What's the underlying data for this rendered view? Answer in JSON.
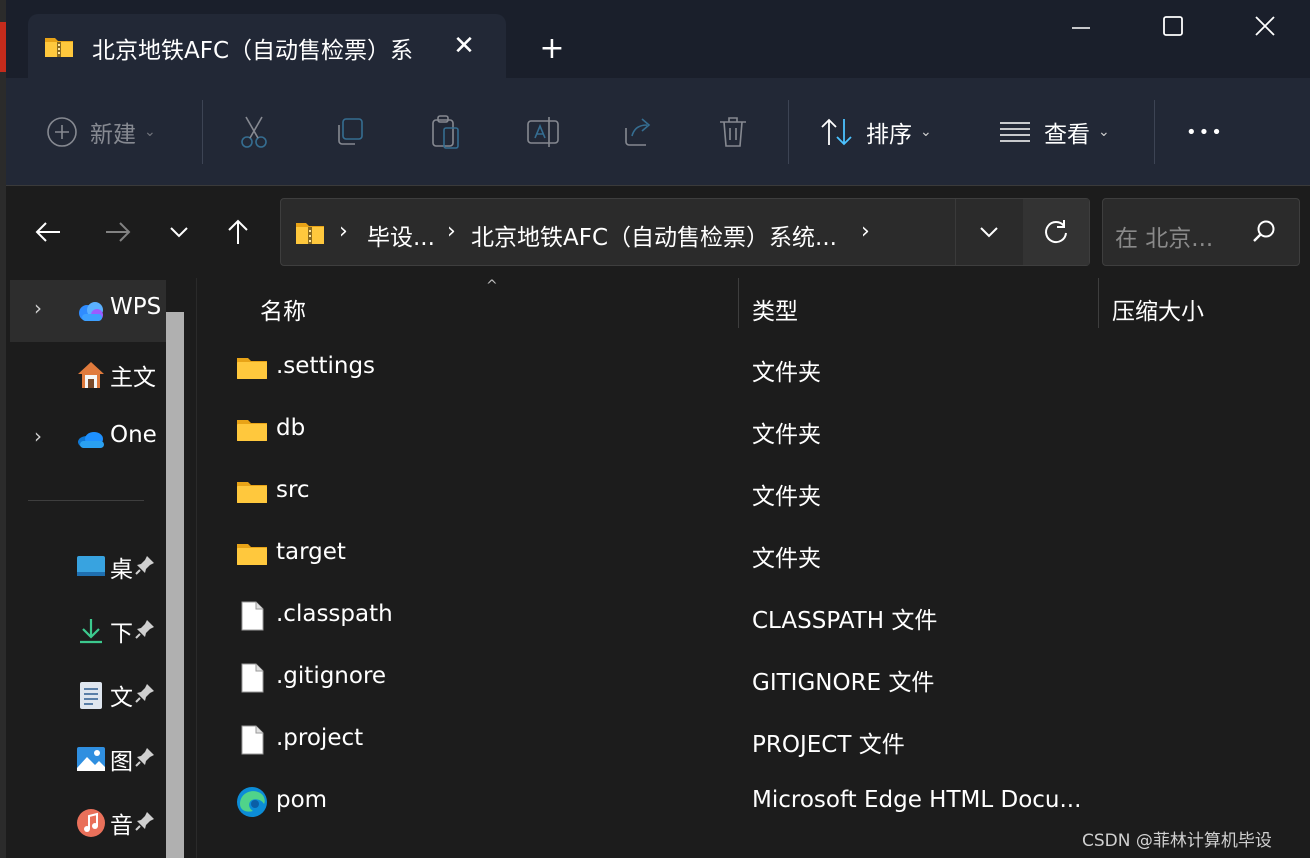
{
  "window": {
    "tab_title": "北京地铁AFC（自动售检票）系",
    "new_tab_symbol": "+",
    "close_tab_symbol": "✕"
  },
  "toolbar": {
    "new_label": "新建",
    "sort_label": "排序",
    "view_label": "查看",
    "more_label": "•••",
    "chevron": "⌄"
  },
  "address": {
    "crumbs": [
      "毕设...",
      "北京地铁AFC（自动售检票）系统..."
    ],
    "separator": "›",
    "search_placeholder": "在 北京..."
  },
  "sidebar": {
    "items": [
      {
        "label": "WPS",
        "icon": "wps-cloud-icon",
        "expandable": true
      },
      {
        "label": "主文",
        "icon": "home-icon",
        "expandable": false
      },
      {
        "label": "One",
        "icon": "onedrive-icon",
        "expandable": true
      }
    ],
    "quick_access": [
      {
        "label": "桌",
        "icon": "desktop-icon"
      },
      {
        "label": "下",
        "icon": "downloads-icon"
      },
      {
        "label": "文",
        "icon": "documents-icon"
      },
      {
        "label": "图",
        "icon": "pictures-icon"
      },
      {
        "label": "音",
        "icon": "music-icon"
      }
    ]
  },
  "columns": {
    "name": "名称",
    "type": "类型",
    "size": "压缩大小"
  },
  "files": [
    {
      "name": ".settings",
      "type": "文件夹",
      "icon": "folder-icon"
    },
    {
      "name": "db",
      "type": "文件夹",
      "icon": "folder-icon"
    },
    {
      "name": "src",
      "type": "文件夹",
      "icon": "folder-icon"
    },
    {
      "name": "target",
      "type": "文件夹",
      "icon": "folder-icon"
    },
    {
      "name": ".classpath",
      "type": "CLASSPATH 文件",
      "icon": "file-icon"
    },
    {
      "name": ".gitignore",
      "type": "GITIGNORE 文件",
      "icon": "file-icon"
    },
    {
      "name": ".project",
      "type": "PROJECT 文件",
      "icon": "file-icon"
    },
    {
      "name": "pom",
      "type": "Microsoft Edge HTML Docu...",
      "icon": "edge-icon"
    }
  ],
  "watermark": "CSDN @菲林计算机毕设",
  "colors": {
    "accent": "#4cc2ff",
    "folder": "#ffc83d",
    "background": "#1c1c1c",
    "titlebar": "#1a1f2b"
  }
}
